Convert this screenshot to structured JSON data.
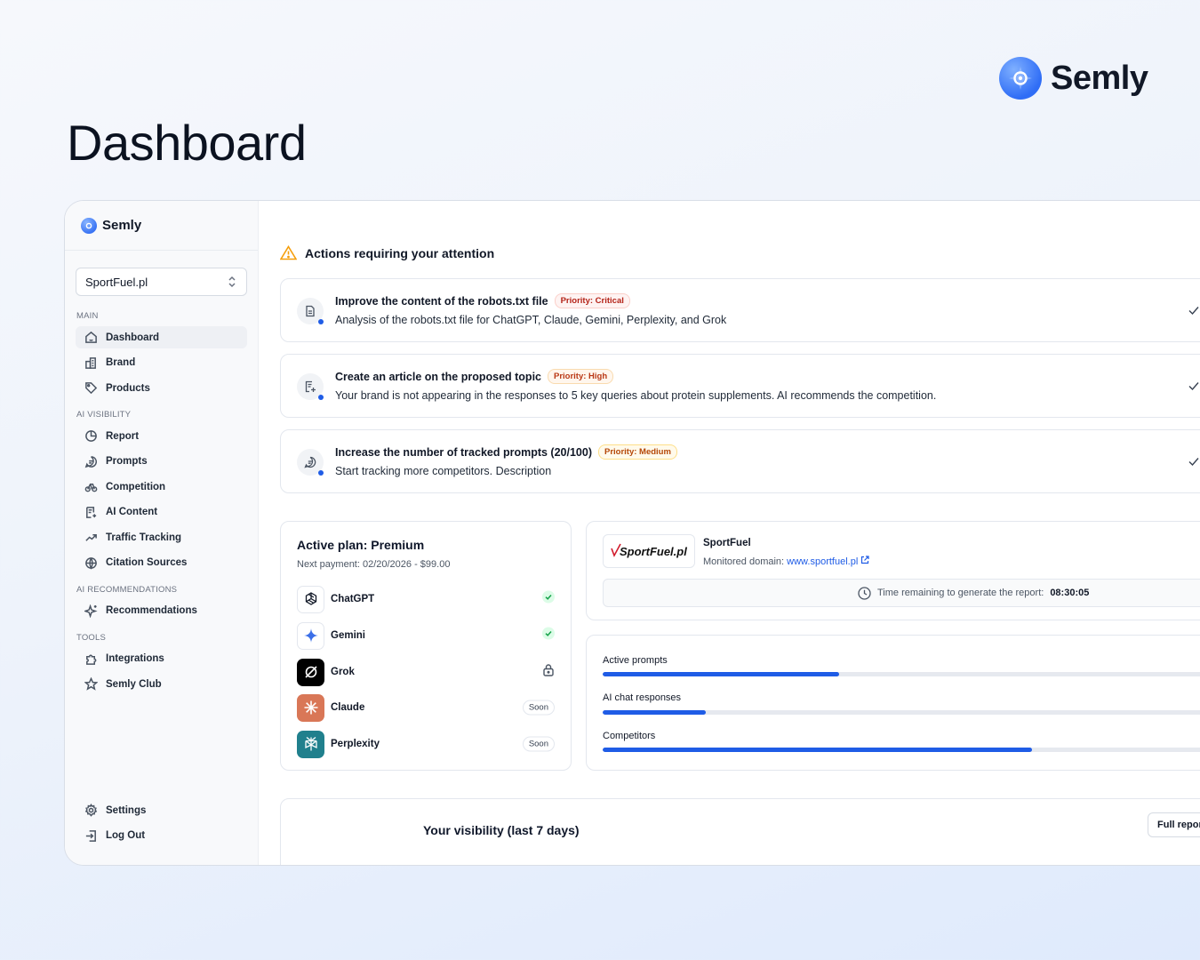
{
  "brand": {
    "name": "Semly"
  },
  "page_title": "Dashboard",
  "sidebar": {
    "app_name": "Semly",
    "site_selector": {
      "value": "SportFuel.pl"
    },
    "sections": {
      "main": "MAIN",
      "ai_visibility": "AI VISIBILITY",
      "ai_recommendations": "AI RECOMMENDATIONS",
      "tools": "TOOLS"
    },
    "items": {
      "dashboard": "Dashboard",
      "brand": "Brand",
      "products": "Products",
      "report": "Report",
      "prompts": "Prompts",
      "competition": "Competition",
      "ai_content": "AI Content",
      "traffic_tracking": "Traffic Tracking",
      "citation_sources": "Citation Sources",
      "recommendations": "Recommendations",
      "integrations": "Integrations",
      "semly_club": "Semly Club",
      "settings": "Settings",
      "log_out": "Log Out"
    }
  },
  "attention": {
    "title": "Actions requiring your attention",
    "actions": [
      {
        "title": "Improve the content of the robots.txt file",
        "priority": "Priority: Critical",
        "description": "Analysis of the robots.txt file for ChatGPT, Claude, Gemini, Perplexity, and Grok"
      },
      {
        "title": "Create an article on the proposed topic",
        "priority": "Priority: High",
        "description": "Your brand is not appearing in the responses to 5 key queries about protein supplements. AI recommends the competition."
      },
      {
        "title": "Increase the number of tracked prompts (20/100)",
        "priority": "Priority: Medium",
        "description": "Start tracking more competitors. Description"
      }
    ]
  },
  "plan": {
    "title": "Active plan: Premium",
    "next_payment": "Next payment: 02/20/2026 - $99.00",
    "providers": [
      {
        "name": "ChatGPT",
        "status": "active"
      },
      {
        "name": "Gemini",
        "status": "active"
      },
      {
        "name": "Grok",
        "status": "locked"
      },
      {
        "name": "Claude",
        "status": "Soon"
      },
      {
        "name": "Perplexity",
        "status": "Soon"
      }
    ]
  },
  "site": {
    "logo_text": "SportFuel.pl",
    "name": "SportFuel",
    "domain_label": "Monitored domain:",
    "domain": "www.sportfuel.pl",
    "timer_label": "Time remaining to generate the report:",
    "timer_value": "08:30:05"
  },
  "usage": [
    {
      "label": "Active prompts",
      "fraction": 0.38
    },
    {
      "label": "AI chat responses",
      "fraction": 0.165
    },
    {
      "label": "Competitors",
      "fraction": 0.69
    }
  ],
  "visibility": {
    "title": "Your visibility (last 7 days)",
    "full_report": "Full report"
  },
  "colors": {
    "accent": "#1f5ce6",
    "success": "#16a34a",
    "claude": "#d97757",
    "perplexity": "#20808d"
  }
}
